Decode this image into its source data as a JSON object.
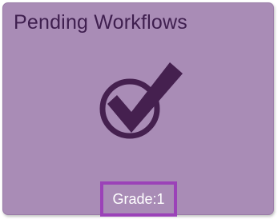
{
  "tile": {
    "title": "Pending Workflows",
    "icon": "checkmark-circle-icon",
    "grade_label": "Grade:1"
  },
  "colors": {
    "tile_background": "#a98cb6",
    "title_text": "#3f1f4f",
    "icon": "#45204f",
    "badge_border": "#9b42b8",
    "badge_text": "#ffffff"
  }
}
